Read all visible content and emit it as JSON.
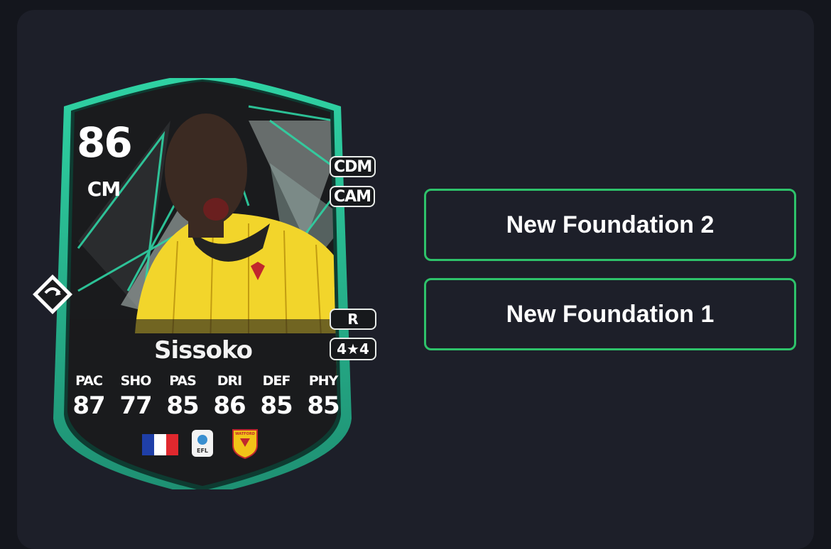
{
  "card": {
    "rating": "86",
    "position": "CM",
    "alt_positions": [
      "CDM",
      "CAM"
    ],
    "name": "Sissoko",
    "weak_foot_badge": "R",
    "skills_badge": "4★4",
    "stats": [
      {
        "label": "PAC",
        "value": "87"
      },
      {
        "label": "SHO",
        "value": "77"
      },
      {
        "label": "PAS",
        "value": "85"
      },
      {
        "label": "DRI",
        "value": "86"
      },
      {
        "label": "DEF",
        "value": "85"
      },
      {
        "label": "PHY",
        "value": "85"
      }
    ],
    "icons": {
      "nation": "france-flag-icon",
      "league": "efl-league-icon",
      "club": "watford-crest-icon",
      "club_text": "WATFORD",
      "league_text": "EFL"
    },
    "colors": {
      "frame_teal": "#2bbf95",
      "card_dark": "#1a1b1d",
      "jersey_yellow": "#f2d52b"
    }
  },
  "evolutions": [
    {
      "label": "New Foundation 2"
    },
    {
      "label": "New Foundation 1"
    }
  ],
  "accent": "#2ec26a"
}
